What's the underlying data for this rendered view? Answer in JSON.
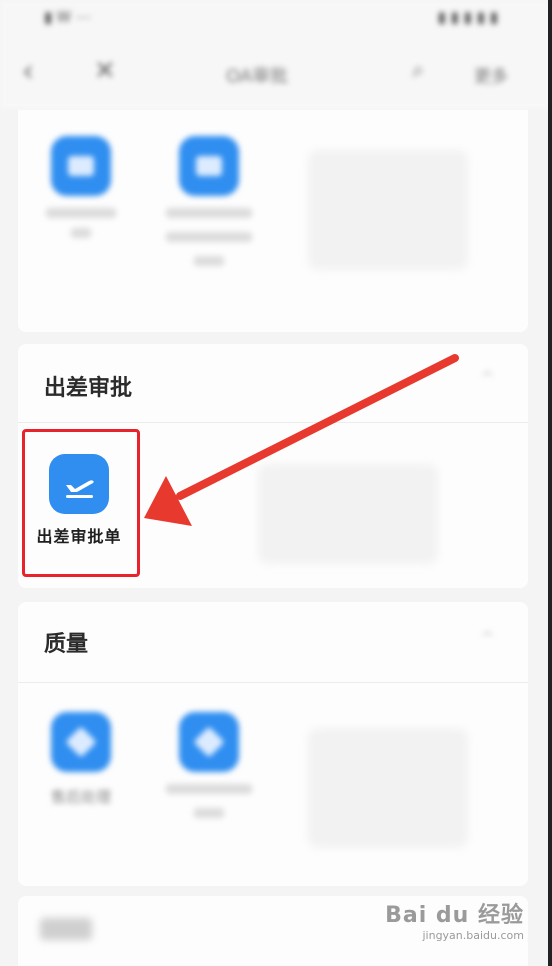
{
  "status_bar": {
    "left": "▮ Ꮃ ⋯",
    "right": "▮ ▮ ▮ ▮ ▮"
  },
  "nav": {
    "back_icon": "‹",
    "close_icon": "✕",
    "title": "OA审批",
    "search_icon": "⌕",
    "more_label": "更多"
  },
  "sections": {
    "top": {
      "apps": [
        {
          "label": "",
          "icon": "doc-icon"
        },
        {
          "label": "",
          "icon": "shield-icon"
        }
      ]
    },
    "business_trip": {
      "title": "出差审批",
      "collapse_icon": "^",
      "apps": [
        {
          "label": "出差审批单",
          "icon": "plane-takeoff-icon"
        }
      ]
    },
    "quality": {
      "title": "质量",
      "collapse_icon": "^",
      "apps": [
        {
          "label": "售后处理",
          "icon": "diamond-icon"
        },
        {
          "label": "",
          "icon": "diamond-icon"
        }
      ]
    },
    "bottom": {
      "title": ""
    }
  },
  "annotation": {
    "highlight_color": "#e8232b",
    "arrow_color": "#e8392f"
  },
  "watermark": {
    "main": "Bai du 经验",
    "sub": "jingyan.baidu.com"
  },
  "colors": {
    "accent": "#2f8ef0",
    "background": "#f4f4f4"
  }
}
